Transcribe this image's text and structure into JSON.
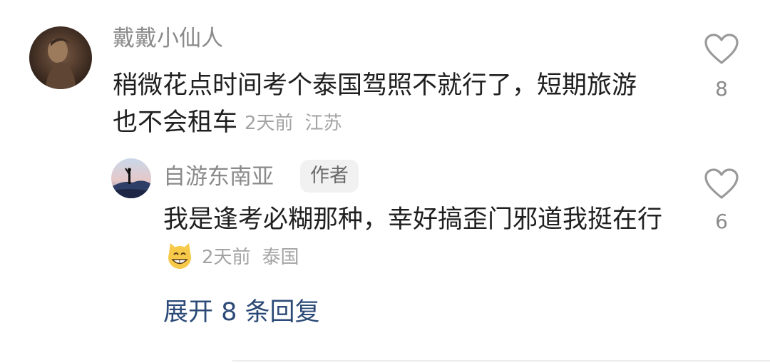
{
  "comments": [
    {
      "username": "戴戴小仙人",
      "text": "稍微花点时间考个泰国驾照不就行了，短期旅游也不会租车",
      "time": "2天前",
      "location": "江苏",
      "likes": "8",
      "avatar": "avatar-dark-portrait"
    }
  ],
  "reply": {
    "username": "自游东南亚",
    "badge": "作者",
    "text": "我是逢考必糊那种，幸好搞歪门邪道我挺在行",
    "emoji": "grinning-cat-emoji",
    "time": "2天前",
    "location": "泰国",
    "likes": "6",
    "avatar": "avatar-silhouette-sunset"
  },
  "expand_replies": "展开 8 条回复",
  "icons": {
    "like": "heart-outline-icon"
  },
  "colors": {
    "username": "#8a8a8a",
    "text": "#1f1f1f",
    "meta": "#a3a3a3",
    "link": "#2c4a77",
    "badge_bg": "#f1f1f1"
  }
}
